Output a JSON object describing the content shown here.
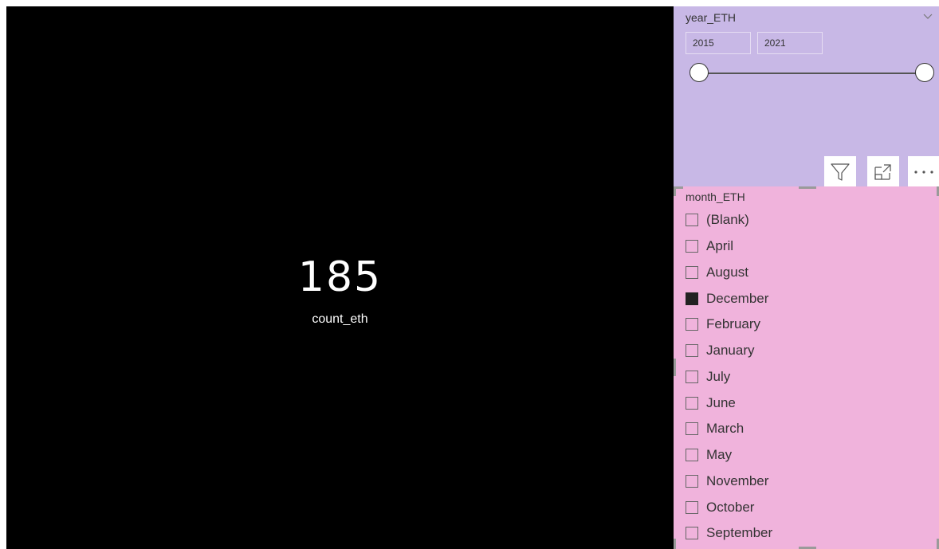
{
  "card": {
    "value": "185",
    "label": "count_eth"
  },
  "year_slicer": {
    "title": "year_ETH",
    "start": "2015",
    "end": "2021",
    "chevron_icon": "chevron-down-icon"
  },
  "toolbar": {
    "filter_icon": "filter-icon",
    "focus_icon": "focus-mode-icon",
    "more_icon": "more-options-icon"
  },
  "month_slicer": {
    "title": "month_ETH",
    "items": [
      {
        "label": "(Blank)",
        "checked": false
      },
      {
        "label": "April",
        "checked": false
      },
      {
        "label": "August",
        "checked": false
      },
      {
        "label": "December",
        "checked": true
      },
      {
        "label": "February",
        "checked": false
      },
      {
        "label": "January",
        "checked": false
      },
      {
        "label": "July",
        "checked": false
      },
      {
        "label": "June",
        "checked": false
      },
      {
        "label": "March",
        "checked": false
      },
      {
        "label": "May",
        "checked": false
      },
      {
        "label": "November",
        "checked": false
      },
      {
        "label": "October",
        "checked": false
      },
      {
        "label": "September",
        "checked": false
      }
    ]
  },
  "colors": {
    "card_bg": "#000000",
    "year_slicer_bg": "#c8b8e6",
    "month_slicer_bg": "#f0b3dc"
  }
}
